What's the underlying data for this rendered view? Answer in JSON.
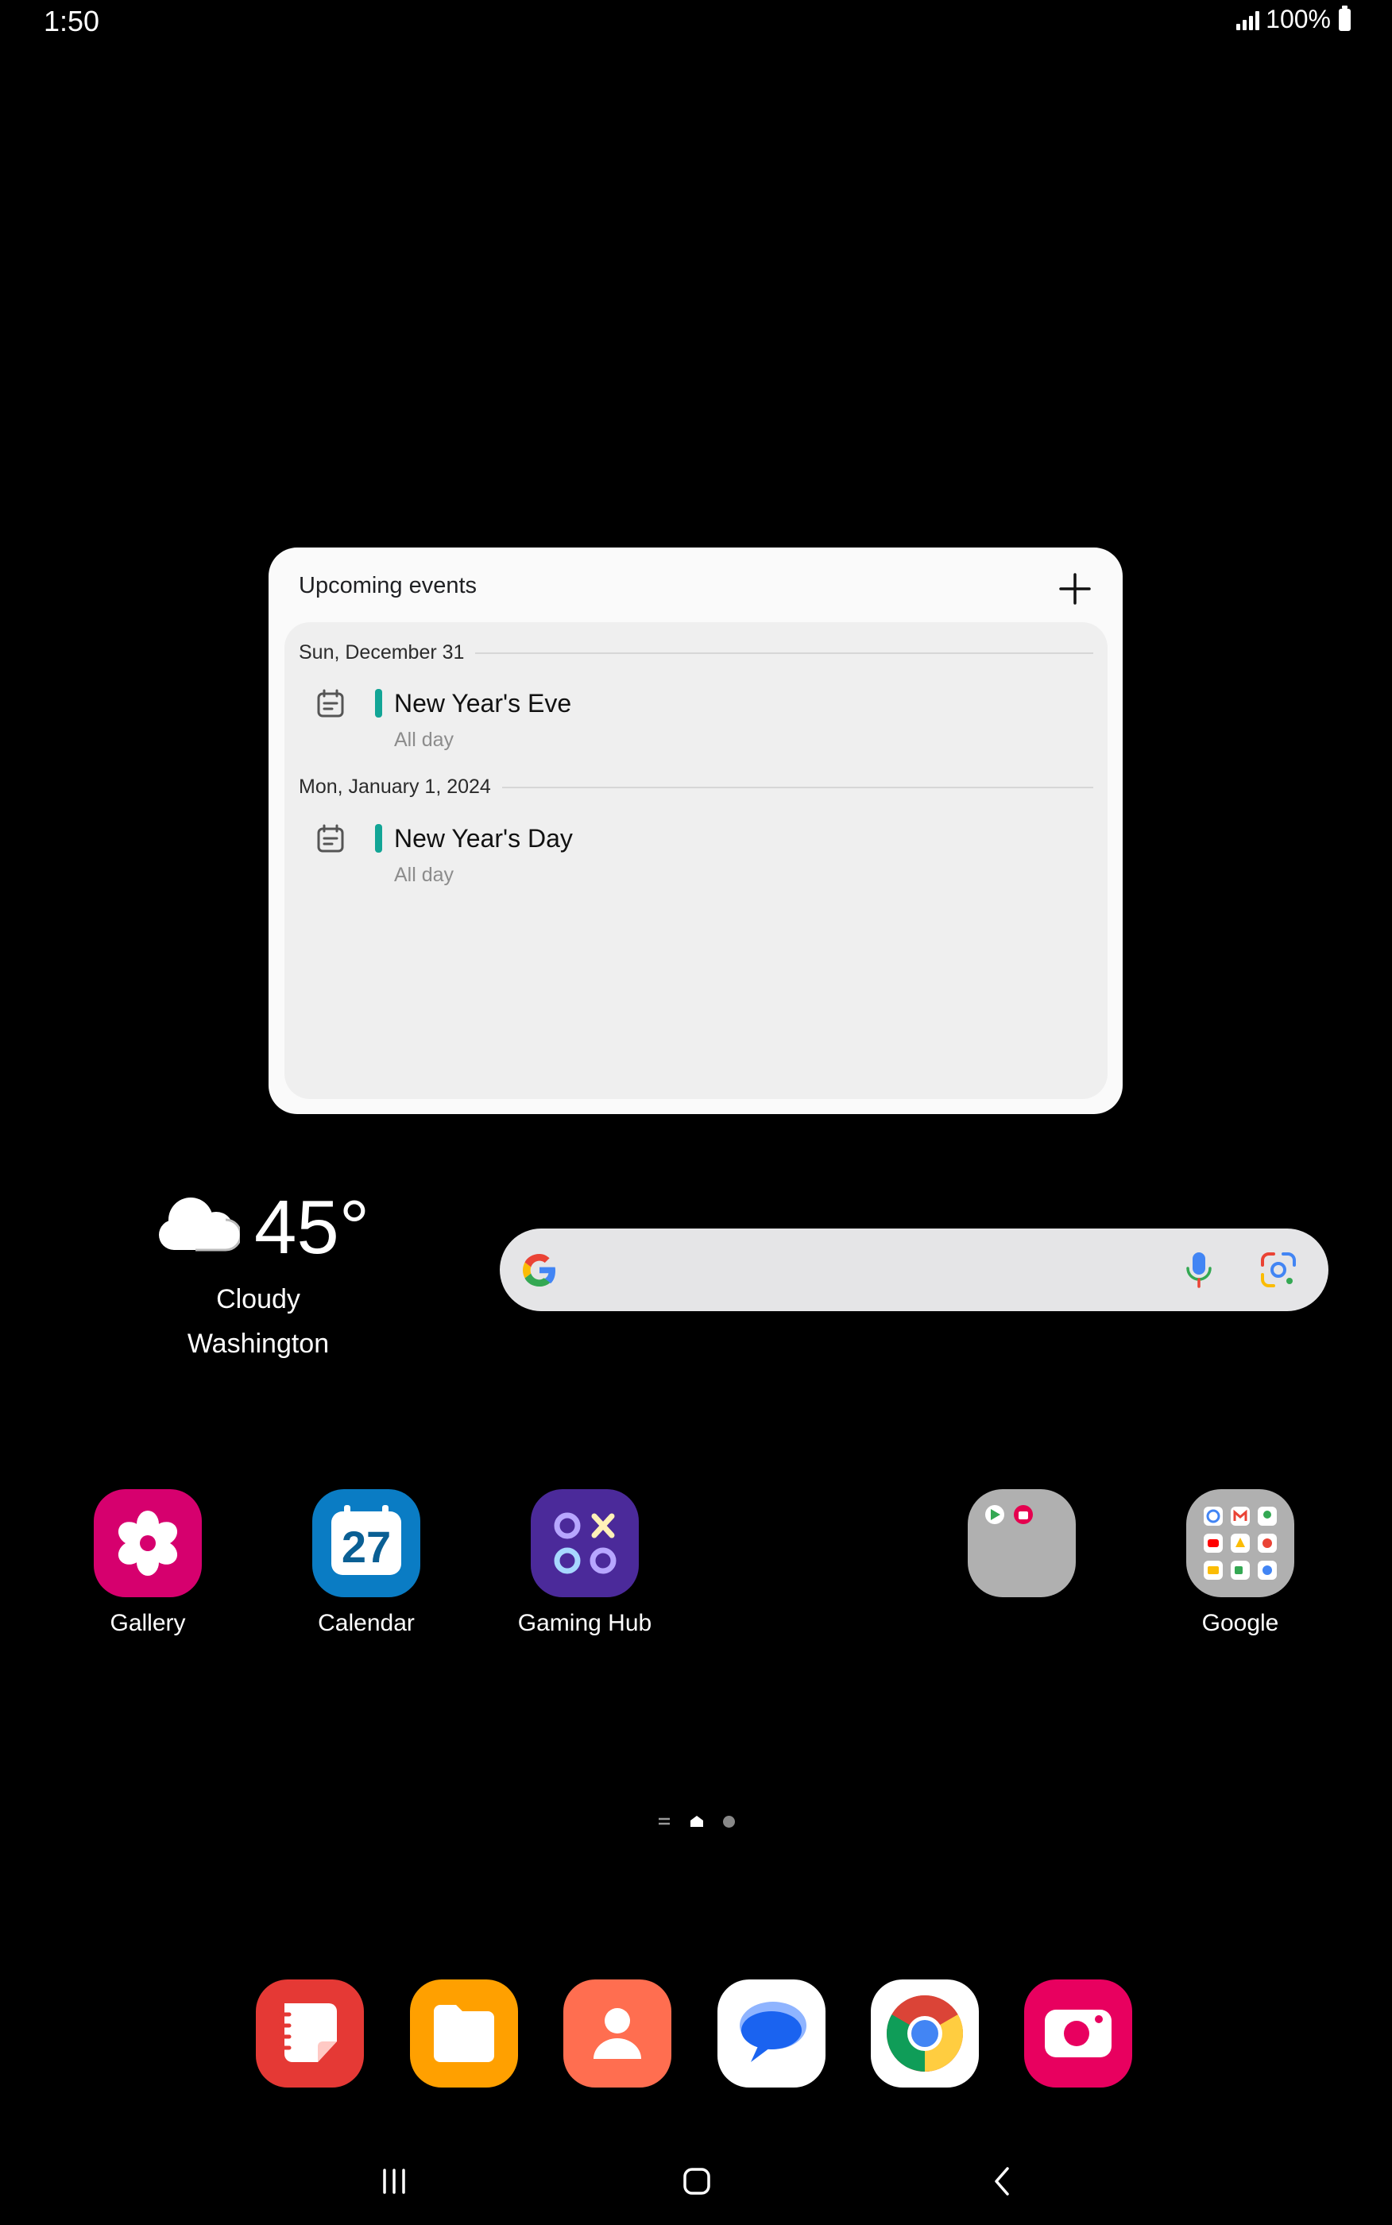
{
  "status_bar": {
    "time": "1:50",
    "battery": "100%"
  },
  "widget": {
    "title": "Upcoming events",
    "add_label": "+",
    "groups": [
      {
        "date": "Sun, December 31",
        "event_title": "New Year's Eve",
        "event_sub": "All day"
      },
      {
        "date": "Mon, January 1, 2024",
        "event_title": "New Year's Day",
        "event_sub": "All day"
      }
    ],
    "accent_color": "#12a596"
  },
  "weather": {
    "temperature": "45°",
    "condition": "Cloudy",
    "location": "Washington"
  },
  "search": {
    "icons": [
      "google-g-icon",
      "microphone-icon",
      "google-lens-icon"
    ]
  },
  "apps": [
    {
      "label": "Gallery",
      "icon": "gallery-flower-icon",
      "color": "#d6006e"
    },
    {
      "label": "Calendar",
      "icon": "calendar-27-icon",
      "date": "27",
      "color": "#0a7cc4"
    },
    {
      "label": "Gaming Hub",
      "icon": "gaming-hub-icon",
      "color": "#4b2a9a"
    },
    {
      "label": "",
      "icon": "folder-icon",
      "color": "#b0b0b0"
    },
    {
      "label": "Google",
      "icon": "google-folder-icon",
      "color": "#b0b0b0"
    }
  ],
  "dock": [
    {
      "icon": "notes-icon",
      "color": "#e53935"
    },
    {
      "icon": "my-files-icon",
      "color": "#ffa000"
    },
    {
      "icon": "contacts-icon",
      "color": "#ff6e50"
    },
    {
      "icon": "messages-icon",
      "color": "#ffffff"
    },
    {
      "icon": "chrome-icon",
      "color": "#ffffff"
    },
    {
      "icon": "camera-icon",
      "color": "#e8005f"
    }
  ],
  "navigation": {
    "buttons": [
      "recents-button",
      "home-button",
      "back-button"
    ]
  }
}
